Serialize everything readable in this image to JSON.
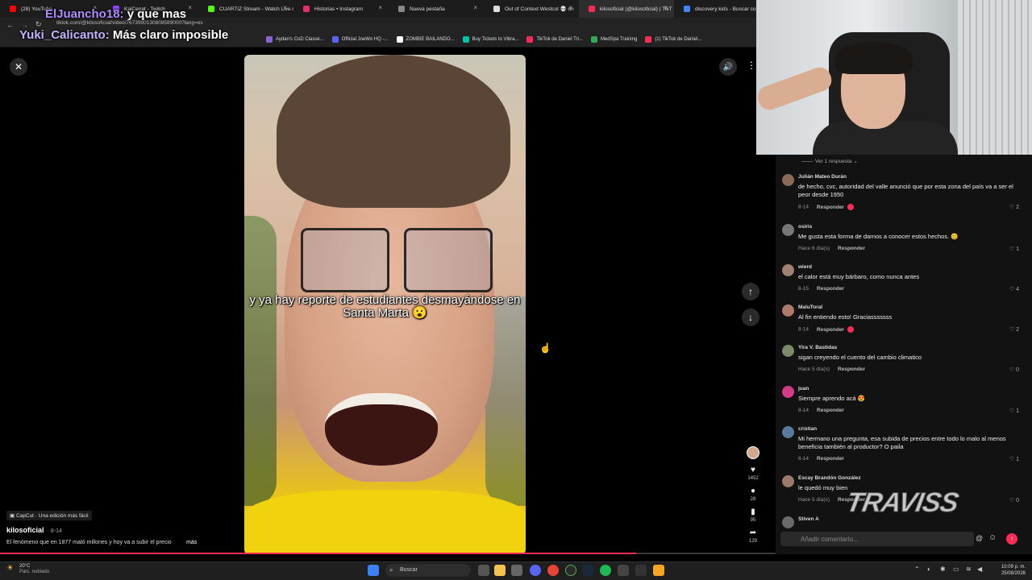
{
  "browser": {
    "tabs": [
      {
        "label": "(28) YouTube",
        "color": "#ff0000"
      },
      {
        "label": "KaiCenat - Twitch",
        "color": "#9146ff"
      },
      {
        "label": "CUARTIZ Stream - Watch Live o",
        "color": "#53fc18"
      },
      {
        "label": "Historias • Instagram",
        "color": "#e1306c"
      },
      {
        "label": "Nueva pestaña",
        "color": "#888888"
      },
      {
        "label": "Out of Context Westcol 💀 on",
        "color": "#dddddd"
      },
      {
        "label": "kilosoficial (@kilosoficial) | TikT",
        "color": "#fe2c55"
      },
      {
        "label": "discovery kids - Buscar co",
        "color": "#4285f4"
      }
    ],
    "url": "tiktok.com/@kilosoficial/video/7673990130809589000?lang=es",
    "bookmarks": [
      {
        "label": "Aydan's CoD Classe...",
        "color": "#8a63d2"
      },
      {
        "label": "Official JoeWo HQ -...",
        "color": "#5865f2"
      },
      {
        "label": "ZOMBIE BAILANDO...",
        "color": "#ffffff"
      },
      {
        "label": "Buy Tickets to Vibra...",
        "color": "#00c2a8"
      },
      {
        "label": "TikTok de Daniel Tri...",
        "color": "#fe2c55"
      },
      {
        "label": "MedSpa Training",
        "color": "#34a853"
      },
      {
        "label": "(1) TikTok de Daniel...",
        "color": "#fe2c55"
      }
    ]
  },
  "stream_overlay": {
    "line1_user": "ElJuancho18:",
    "line1_msg": "y que mas",
    "line2_user": "Yuki_Calicanto:",
    "line2_msg": "Más claro imposible"
  },
  "video": {
    "caption": "y ya hay reporte de estudiantes desmayándose en Santa Marta 😮",
    "capcut_tag": "CapCut · Una edición más fácil",
    "author": "kilosoficial",
    "date": "8-14",
    "description": "El fenómeno que en 1877 mató millones y hoy va a subir el precio",
    "more_label": "más",
    "progress_fraction": 0.82,
    "likes": "1452",
    "comments": "28",
    "saves": "95",
    "shares": "129"
  },
  "comments": {
    "view_replies": "Ver 1 respuesta",
    "reply_label": "Responder",
    "items": [
      {
        "name": "Julián Mateo Durán",
        "text": "de hecho, cvc, autoridad del valle anunció que por esta zona del país va a ser el peor desde 1950",
        "meta": "8-14",
        "likes": "2",
        "creator_liked": true,
        "color": "#8a6a5a"
      },
      {
        "name": "osiris",
        "text": "Me gusta esta forma de darnos a conocer estos hechos. 😊",
        "meta": "Hace 6 día(s)",
        "likes": "1",
        "creator_liked": false,
        "color": "#777777"
      },
      {
        "name": "wierd",
        "text": "el calor está muy bárbaro, como nunca antes",
        "meta": "8-15",
        "likes": "4",
        "creator_liked": false,
        "color": "#a08070"
      },
      {
        "name": "MaluToral",
        "text": "Al fin entiendo esto! Graciasssssss",
        "meta": "8-14",
        "likes": "2",
        "creator_liked": true,
        "color": "#b07a6a"
      },
      {
        "name": "Yira V. Bastidas",
        "text": "sigan creyendo el cuento del cambio climatico",
        "meta": "Hace 5 día(s)",
        "likes": "0",
        "creator_liked": false,
        "color": "#7a8a6a"
      },
      {
        "name": "juan",
        "text": "Siempre aprendo acá 😍",
        "meta": "8-14",
        "likes": "1",
        "creator_liked": false,
        "color": "#d63a8a"
      },
      {
        "name": "cristian",
        "text": "Mi hermano una pregunta, esa subida de precios entre todo lo malo al menos beneficia también al productor? O paila",
        "meta": "8-14",
        "likes": "1",
        "creator_liked": false,
        "color": "#5a7a9a"
      },
      {
        "name": "Escay Brandón González",
        "text": "le quedó muy bien",
        "meta": "Hace 5 día(s)",
        "likes": "0",
        "creator_liked": false,
        "color": "#9a7a6a"
      },
      {
        "name": "Stiven A",
        "text": "",
        "meta": "",
        "likes": "",
        "creator_liked": false,
        "color": "#6a6a6a"
      }
    ],
    "input_placeholder": "Añadir comentario..."
  },
  "watermark": "TRAVISS",
  "taskbar": {
    "weather_temp": "20°C",
    "weather_desc": "Parc. nublado",
    "search_placeholder": "Buscar",
    "time": "10:09 p. m.",
    "date": "25/08/2026"
  }
}
